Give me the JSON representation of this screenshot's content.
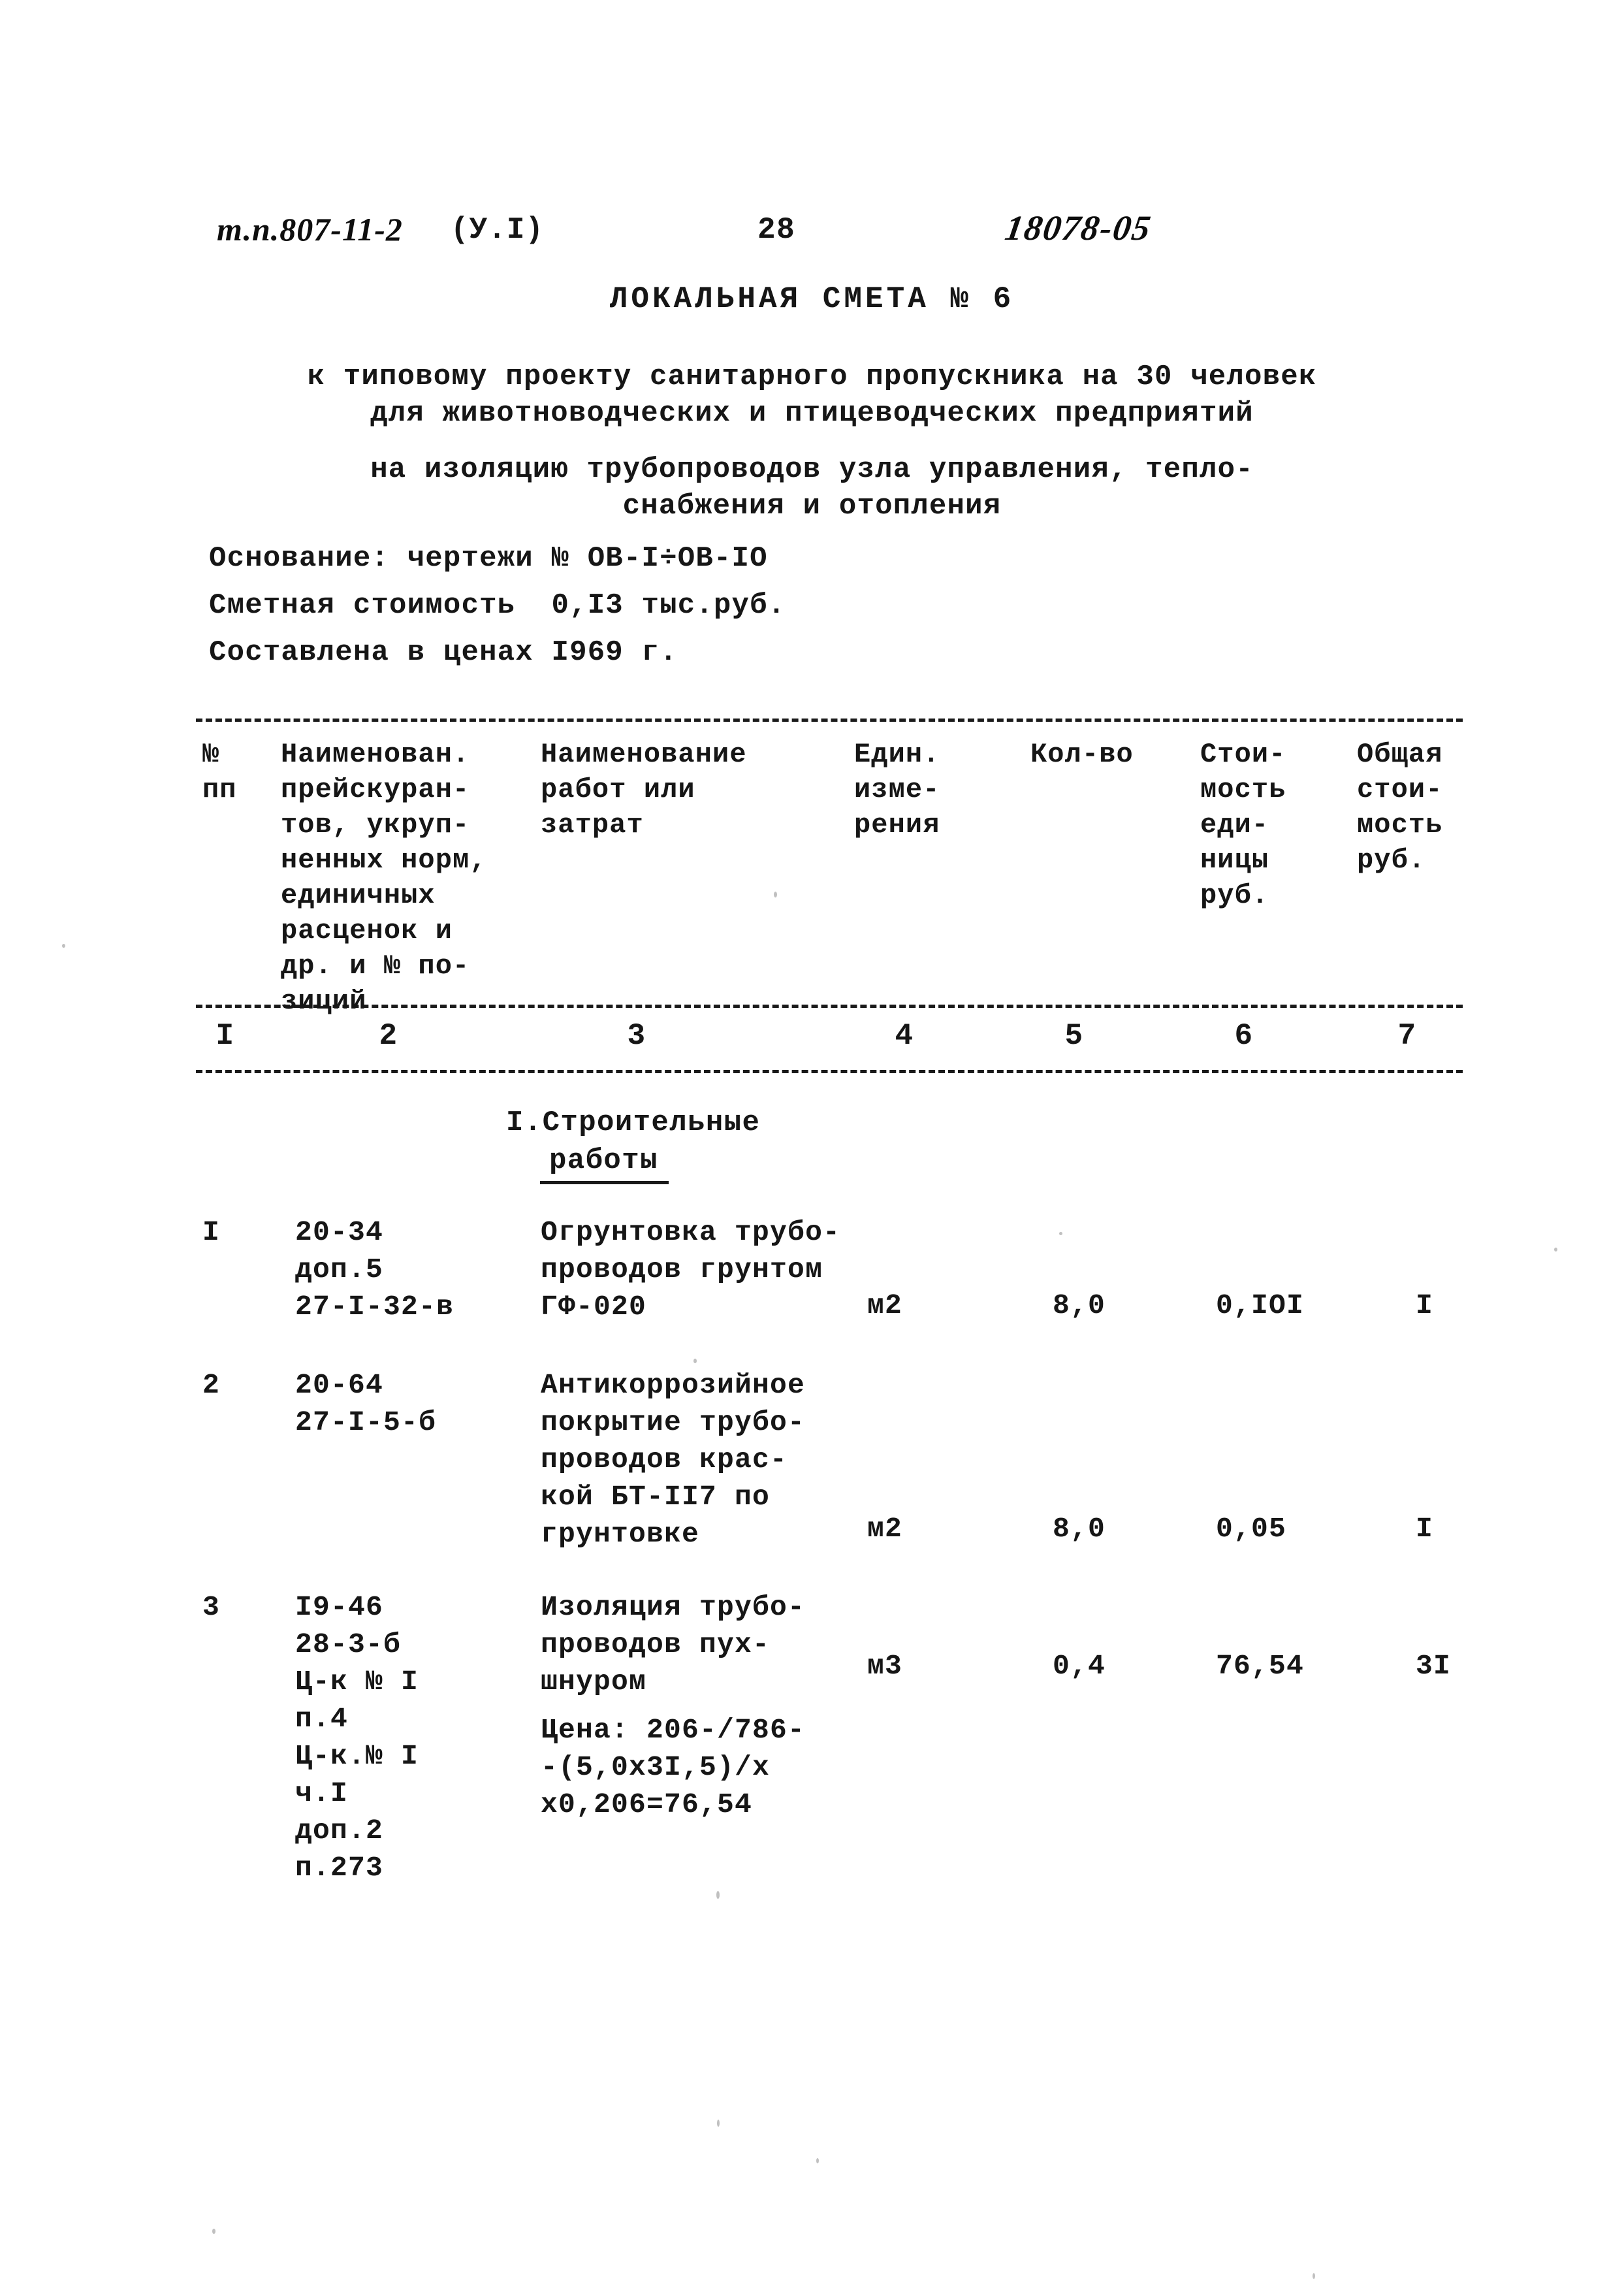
{
  "header": {
    "doc_code": "т.п.807-11-2",
    "variant": "(У.I)",
    "page_number": "28",
    "archive_code": "18078-05"
  },
  "title": {
    "main": "ЛОКАЛЬНАЯ СМЕТА № 6",
    "line1": "к типовому проекту санитарного пропускника на 30 человек",
    "line2": "для животноводческих и птицеводческих предприятий",
    "line3": "на изоляцию трубопроводов узла управления, тепло-",
    "line4": "снабжения и отопления"
  },
  "basis": {
    "drawings": "Основание: чертежи № ОВ-I÷ОВ-IО",
    "estimate_cost": "Сметная стоимость  0,I3 тыс.руб.",
    "price_year": "Составлена в ценах I969 г."
  },
  "table": {
    "headers": {
      "num": "№\nпп",
      "price_list": "Наименован.\nпрейскуран-\nтов, укруп-\nненных норм,\nединичных\nрасценок и\nдр. и № по-\nзиций",
      "work": "Наименование\nработ или\nзатрат",
      "unit": "Един.\nизме-\nрения",
      "quantity": "Кол-во",
      "unit_cost": "Стои-\nмость\nеди-\nницы\nруб.",
      "total_cost": "Общая\nстои-\nмость\nруб."
    },
    "column_numbers": [
      "I",
      "2",
      "3",
      "4",
      "5",
      "6",
      "7"
    ],
    "sections": [
      {
        "heading_line1": "I.Строительные",
        "heading_line2": "работы",
        "rows": [
          {
            "num": "I",
            "code": "20-34\nдоп.5\n27-I-32-в",
            "work": "Огрунтовка трубо-\nпроводов грунтом\nГФ-020",
            "unit": "м2",
            "quantity": "8,0",
            "unit_cost": "0,IOI",
            "total_cost": "I",
            "formula": ""
          },
          {
            "num": "2",
            "code": "20-64\n27-I-5-б",
            "work": "Антикоррозийное\nпокрытие трубо-\nпроводов крас-\nкой БТ-II7 по\nгрунтовке",
            "unit": "м2",
            "quantity": "8,0",
            "unit_cost": "0,05",
            "total_cost": "I",
            "formula": ""
          },
          {
            "num": "3",
            "code": "I9-46\n28-3-б\nЦ-к № I\nп.4\nЦ-к.№ I\nч.I\nдоп.2\nп.273",
            "work": "Изоляция трубо-\nпроводов пух-\nшнуром",
            "unit": "м3",
            "quantity": "0,4",
            "unit_cost": "76,54",
            "total_cost": "3I",
            "formula": "Цена: 206-/786-\n-(5,0х3I,5)/х\nх0,206=76,54"
          }
        ]
      }
    ]
  }
}
